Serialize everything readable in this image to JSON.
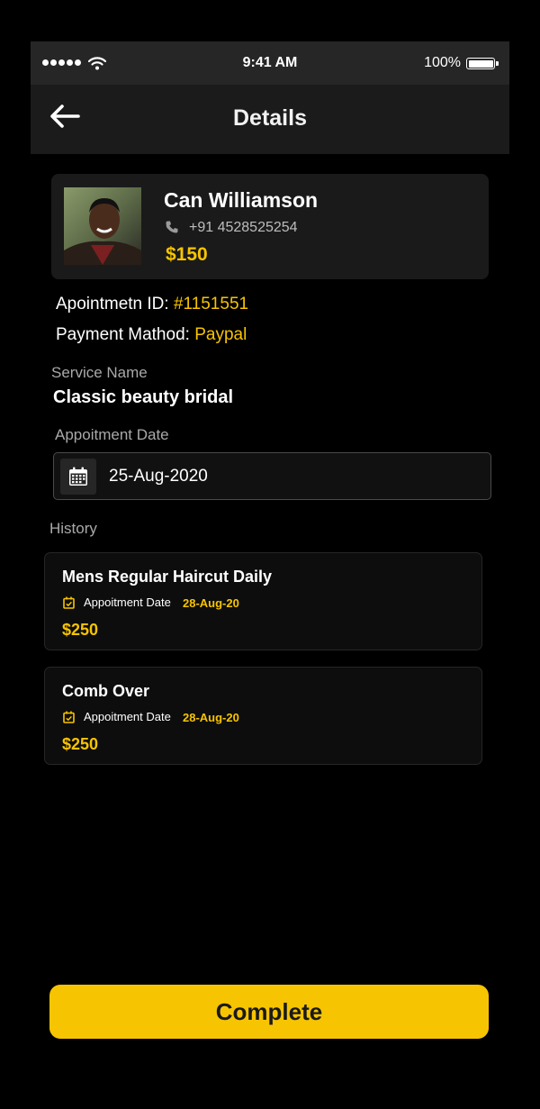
{
  "status_bar": {
    "time": "9:41 AM",
    "battery": "100%"
  },
  "header": {
    "title": "Details"
  },
  "profile": {
    "name": "Can Williamson",
    "phone": "+91 4528525254",
    "price": "$150"
  },
  "appointment": {
    "id_label": "Apointmetn ID:",
    "id_value": "#1151551",
    "payment_label": "Payment Mathod:",
    "payment_value": "Paypal"
  },
  "service": {
    "label": "Service Name",
    "name": "Classic beauty bridal"
  },
  "date": {
    "label": "Appoitment Date",
    "value": "25-Aug-2020"
  },
  "history": {
    "label": "History",
    "items": [
      {
        "title": "Mens Regular  Haircut Daily",
        "date_label": "Appoitment Date",
        "date": "28-Aug-20",
        "price": "$250"
      },
      {
        "title": "Comb Over",
        "date_label": "Appoitment Date",
        "date": "28-Aug-20",
        "price": "$250"
      }
    ]
  },
  "actions": {
    "complete_label": "Complete"
  },
  "colors": {
    "accent": "#f7c401",
    "background": "#000000",
    "card": "#1a1a1a"
  }
}
